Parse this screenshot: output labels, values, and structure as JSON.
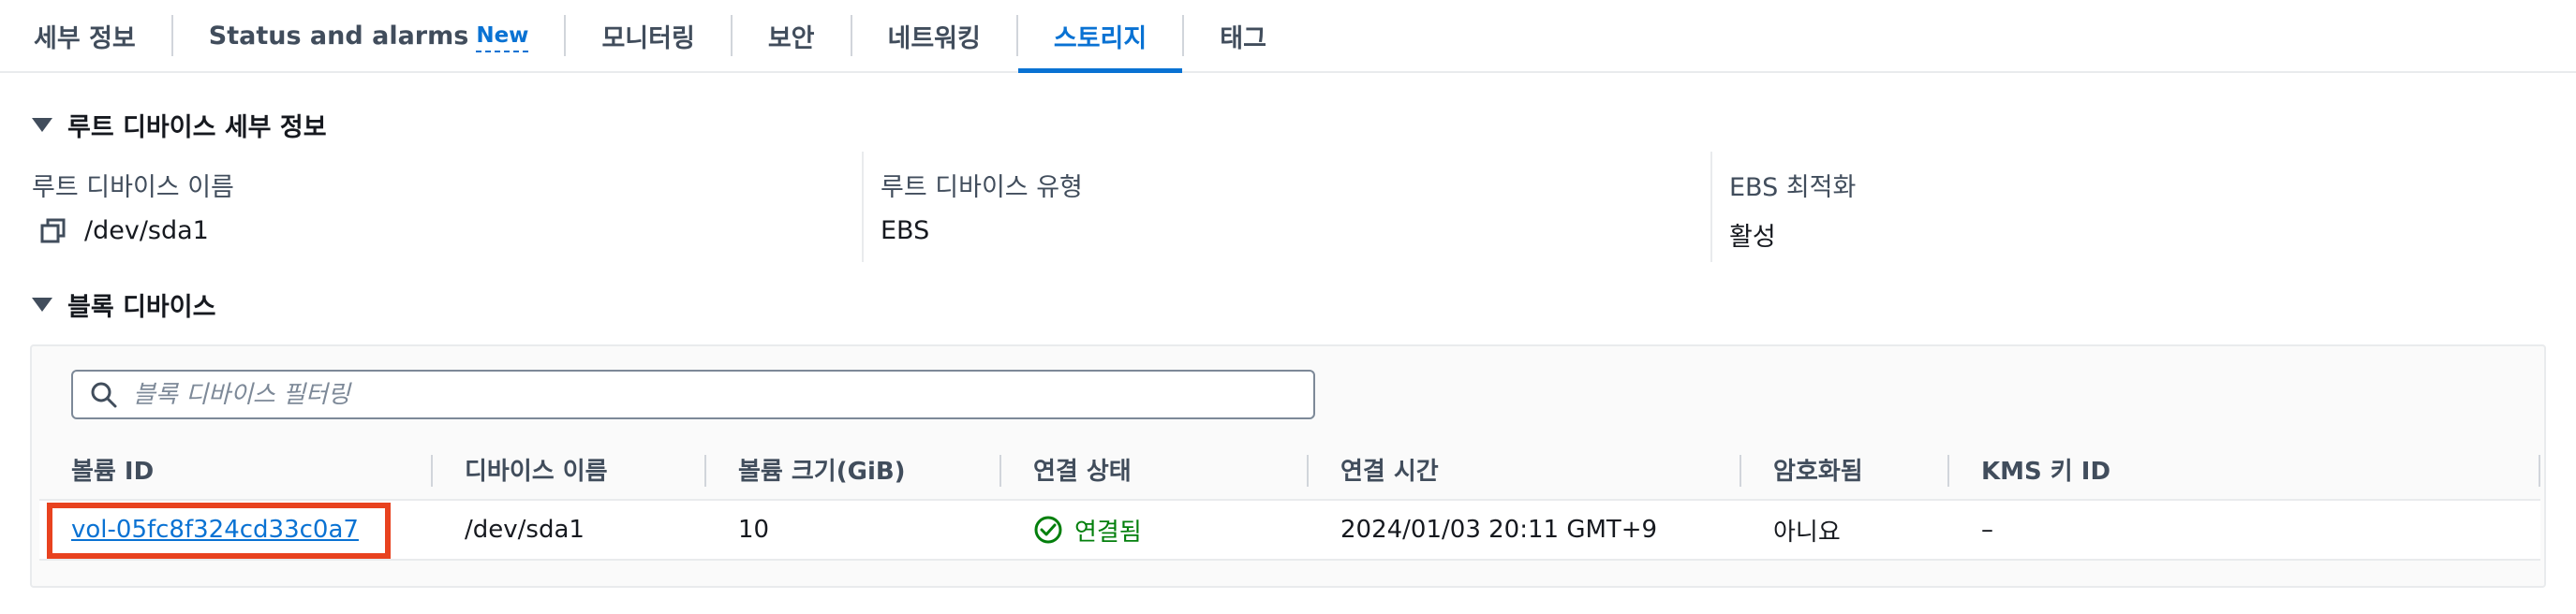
{
  "tabs": [
    {
      "label": "세부 정보"
    },
    {
      "label": "Status and alarms",
      "badge": "New"
    },
    {
      "label": "모니터링"
    },
    {
      "label": "보안"
    },
    {
      "label": "네트워킹"
    },
    {
      "label": "스토리지",
      "active": true
    },
    {
      "label": "태그"
    }
  ],
  "root_device": {
    "title": "루트 디바이스 세부 정보",
    "name_label": "루트 디바이스 이름",
    "name_value": "/dev/sda1",
    "type_label": "루트 디바이스 유형",
    "type_value": "EBS",
    "ebs_opt_label": "EBS 최적화",
    "ebs_opt_value": "활성"
  },
  "block_devices": {
    "title": "블록 디바이스",
    "filter_placeholder": "블록 디바이스 필터링",
    "columns": [
      "볼륨 ID",
      "디바이스 이름",
      "볼륨 크기(GiB)",
      "연결 상태",
      "연결 시간",
      "암호화됨",
      "KMS 키 ID"
    ],
    "rows": [
      {
        "volume_id": "vol-05fc8f324cd33c0a7",
        "device_name": "/dev/sda1",
        "size": "10",
        "status": "연결됨",
        "attach_time": "2024/01/03 20:11 GMT+9",
        "encrypted": "아니요",
        "kms_key": "–"
      }
    ]
  },
  "colors": {
    "accent": "#0972d3",
    "success": "#037f0c",
    "highlight": "#e8421f"
  }
}
